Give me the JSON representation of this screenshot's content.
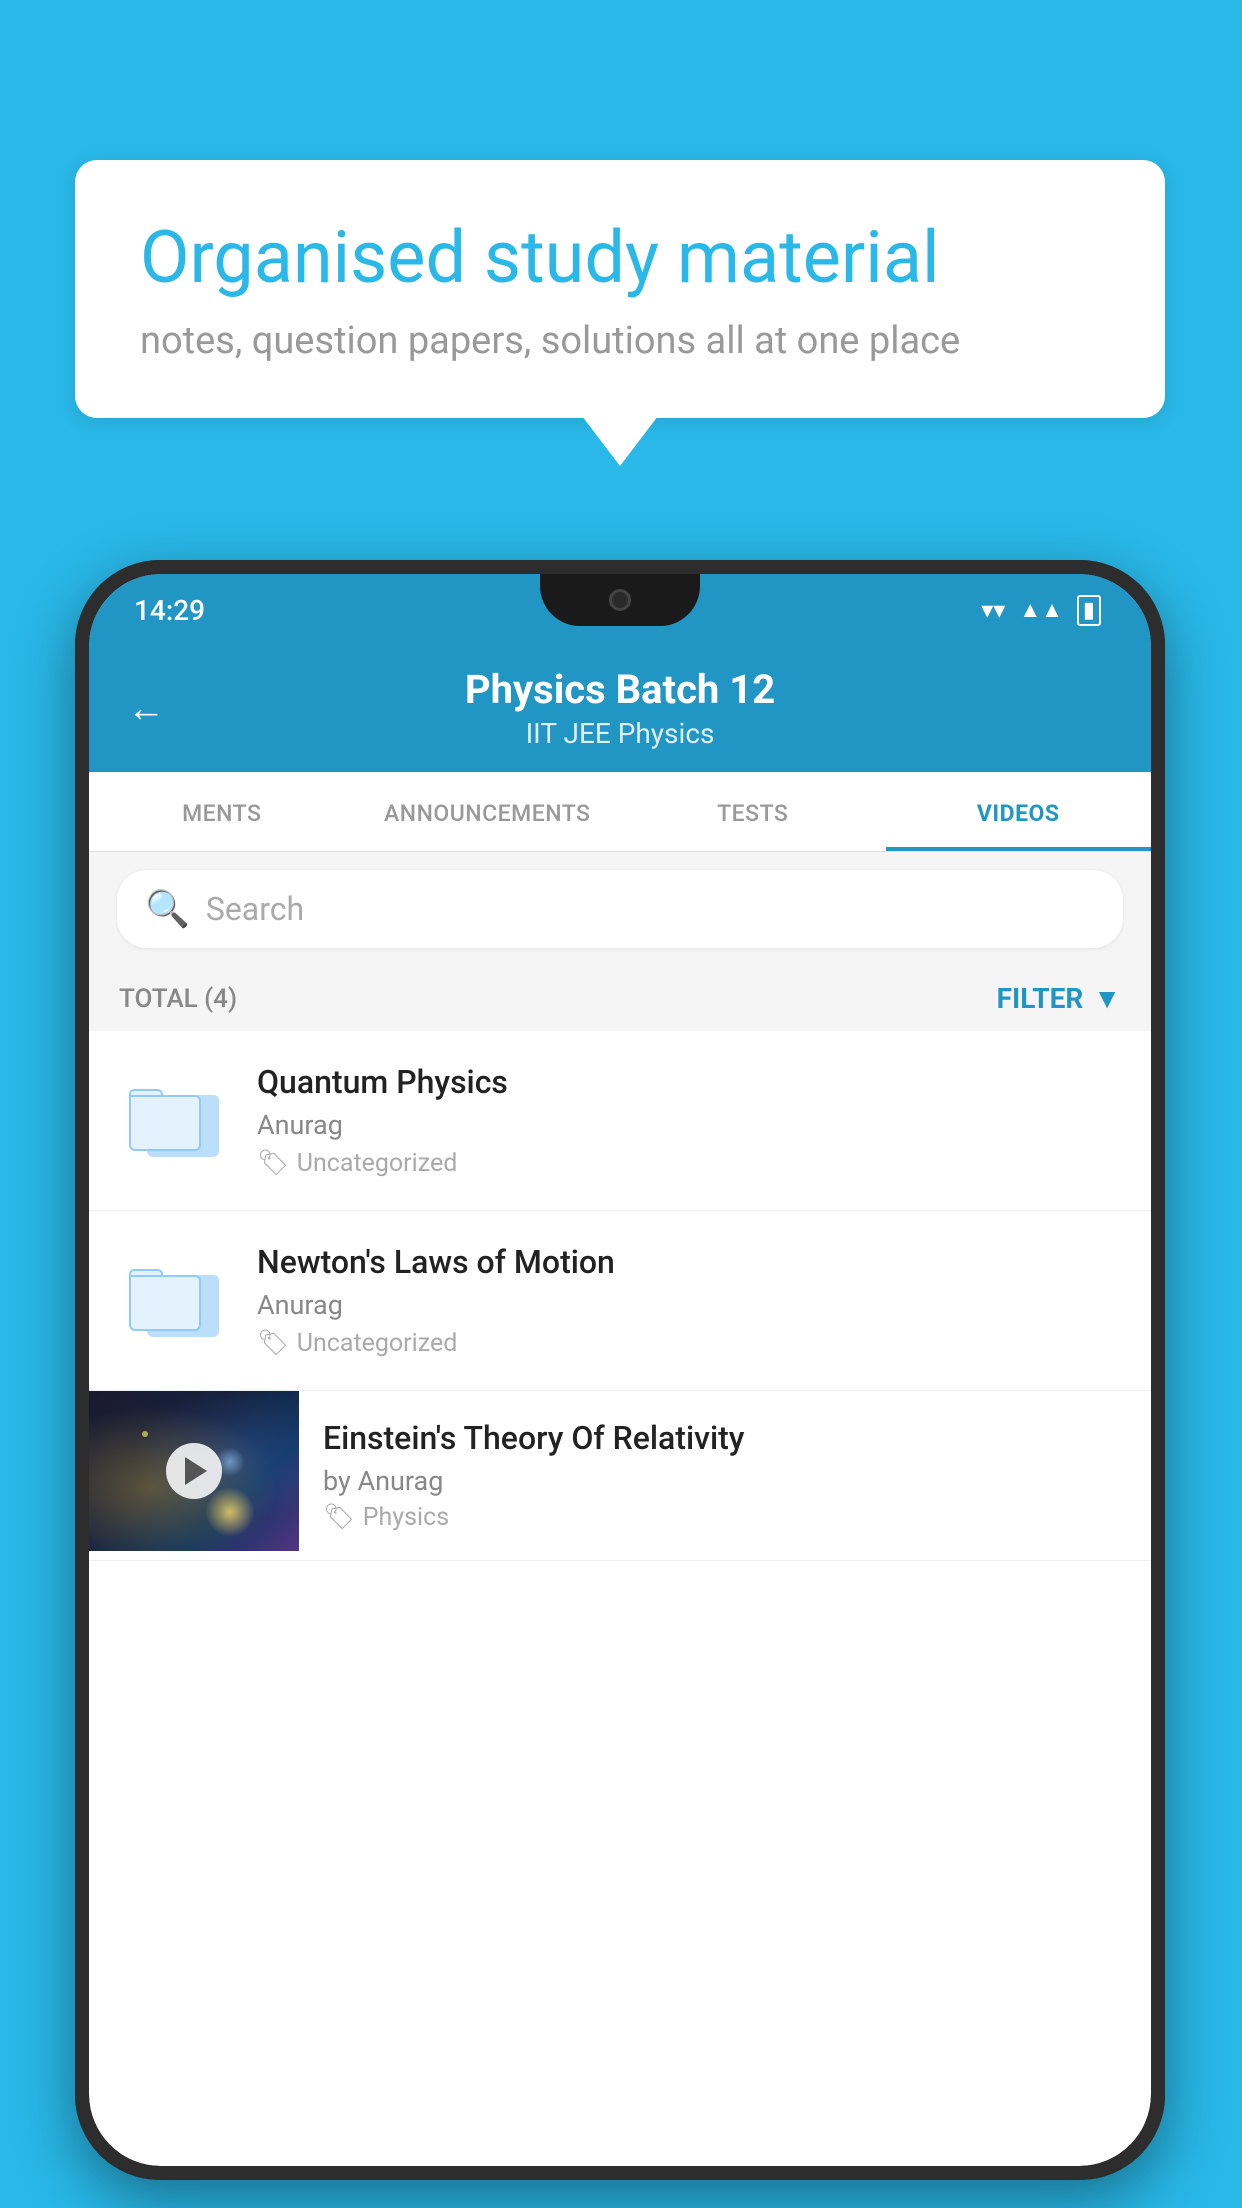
{
  "background_color": "#29b8e8",
  "bubble": {
    "title": "Organised study material",
    "subtitle": "notes, question papers, solutions all at one place"
  },
  "phone": {
    "status_bar": {
      "time": "14:29",
      "wifi": "▼",
      "signal": "▲",
      "battery": "▮"
    },
    "header": {
      "title": "Physics Batch 12",
      "subtitle": "IIT JEE   Physics",
      "back_label": "←"
    },
    "tabs": [
      {
        "label": "MENTS",
        "active": false
      },
      {
        "label": "ANNOUNCEMENTS",
        "active": false
      },
      {
        "label": "TESTS",
        "active": false
      },
      {
        "label": "VIDEOS",
        "active": true
      }
    ],
    "search": {
      "placeholder": "Search"
    },
    "filter_bar": {
      "total_label": "TOTAL (4)",
      "filter_label": "FILTER"
    },
    "items": [
      {
        "type": "folder",
        "title": "Quantum Physics",
        "author": "Anurag",
        "tag": "Uncategorized"
      },
      {
        "type": "folder",
        "title": "Newton's Laws of Motion",
        "author": "Anurag",
        "tag": "Uncategorized"
      },
      {
        "type": "video",
        "title": "Einstein's Theory Of Relativity",
        "author": "by Anurag",
        "tag": "Physics"
      }
    ]
  }
}
